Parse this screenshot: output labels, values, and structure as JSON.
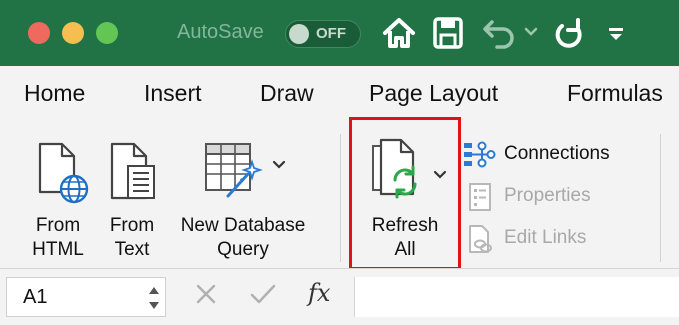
{
  "titlebar": {
    "autosave_label": "AutoSave",
    "autosave_state": "OFF",
    "accent_color": "#217346"
  },
  "tabs": [
    {
      "label": "Home"
    },
    {
      "label": "Insert"
    },
    {
      "label": "Draw"
    },
    {
      "label": "Page Layout"
    },
    {
      "label": "Formulas"
    }
  ],
  "ribbon": {
    "from_html": {
      "line1": "From",
      "line2": "HTML",
      "icon": "html-document-globe-icon"
    },
    "from_text": {
      "line1": "From",
      "line2": "Text",
      "icon": "text-document-icon"
    },
    "new_db_query": {
      "line1": "New Database",
      "line2": "Query",
      "icon": "database-query-icon"
    },
    "refresh_all": {
      "line1": "Refresh",
      "line2": "All",
      "icon": "refresh-document-icon",
      "highlighted": true
    },
    "side": [
      {
        "label": "Connections",
        "enabled": true,
        "icon": "connections-icon"
      },
      {
        "label": "Properties",
        "enabled": false,
        "icon": "properties-icon"
      },
      {
        "label": "Edit Links",
        "enabled": false,
        "icon": "edit-links-icon"
      }
    ],
    "highlight_color": "#e01313"
  },
  "formula_bar": {
    "name_box": "A1",
    "fx_label": "fx"
  }
}
